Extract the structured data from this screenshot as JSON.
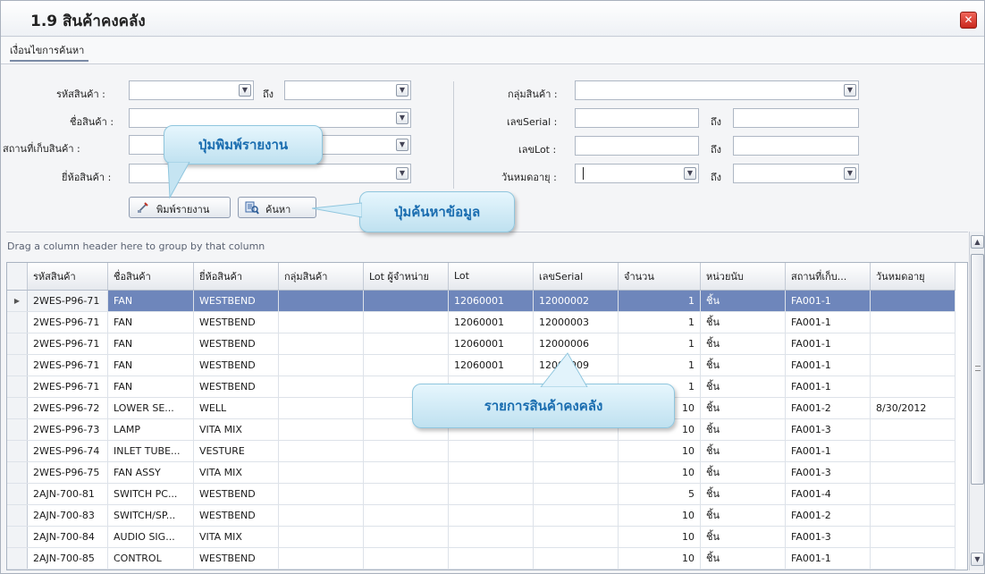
{
  "window": {
    "title": "1.9 สินค้าคงคลัง",
    "close_glyph": "✕"
  },
  "search": {
    "tab_label": "เงื่อนไขการค้นหา",
    "fields": {
      "product_code": {
        "label": "รหัสสินค้า :",
        "to_label": "ถึง"
      },
      "product_name": {
        "label": "ชื่อสินค้า :"
      },
      "location": {
        "label": "สถานที่เก็บสินค้า :"
      },
      "brand": {
        "label": "ยี่ห้อสินค้า :"
      },
      "product_group": {
        "label": "กลุ่มสินค้า :"
      },
      "serial": {
        "label": "เลขSerial :",
        "to_label": "ถึง"
      },
      "lot": {
        "label": "เลขLot :",
        "to_label": "ถึง"
      },
      "expiry": {
        "label": "วันหมดอายุ :",
        "to_label": "ถึง"
      }
    },
    "buttons": {
      "print": "พิมพ์รายงาน",
      "search": "ค้นหา"
    }
  },
  "callouts": {
    "print": "ปุ่มพิมพ์รายงาน",
    "search": "ปุ่มค้นหาข้อมูล",
    "grid": "รายการสินค้าคงคลัง"
  },
  "grid": {
    "group_hint": "Drag a column header here to group by that column",
    "columns": [
      "รหัสสินค้า",
      "ชื่อสินค้า",
      "ยี่ห้อสินค้า",
      "กลุ่มสินค้า",
      "Lot ผู้จำหน่าย",
      "Lot",
      "เลขSerial",
      "จำนวน",
      "หน่วยนับ",
      "สถานที่เก็บ...",
      "วันหมดอายุ"
    ],
    "rows": [
      [
        "2WES-P96-71",
        "FAN",
        "WESTBEND",
        "",
        "",
        "12060001",
        "12000002",
        "1",
        "ชิ้น",
        "FA001-1",
        ""
      ],
      [
        "2WES-P96-71",
        "FAN",
        "WESTBEND",
        "",
        "",
        "12060001",
        "12000003",
        "1",
        "ชิ้น",
        "FA001-1",
        ""
      ],
      [
        "2WES-P96-71",
        "FAN",
        "WESTBEND",
        "",
        "",
        "12060001",
        "12000006",
        "1",
        "ชิ้น",
        "FA001-1",
        ""
      ],
      [
        "2WES-P96-71",
        "FAN",
        "WESTBEND",
        "",
        "",
        "12060001",
        "12000009",
        "1",
        "ชิ้น",
        "FA001-1",
        ""
      ],
      [
        "2WES-P96-71",
        "FAN",
        "WESTBEND",
        "",
        "",
        "",
        "",
        "1",
        "ชิ้น",
        "FA001-1",
        ""
      ],
      [
        "2WES-P96-72",
        "LOWER SE...",
        "WELL",
        "",
        "",
        "",
        "",
        "10",
        "ชิ้น",
        "FA001-2",
        "8/30/2012"
      ],
      [
        "2WES-P96-73",
        "LAMP",
        "VITA MIX",
        "",
        "",
        "",
        "",
        "10",
        "ชิ้น",
        "FA001-3",
        ""
      ],
      [
        "2WES-P96-74",
        "INLET TUBE...",
        "VESTURE",
        "",
        "",
        "",
        "",
        "10",
        "ชิ้น",
        "FA001-1",
        ""
      ],
      [
        "2WES-P96-75",
        "FAN ASSY",
        "VITA MIX",
        "",
        "",
        "",
        "",
        "10",
        "ชิ้น",
        "FA001-3",
        ""
      ],
      [
        "2AJN-700-81",
        "SWITCH PC...",
        "WESTBEND",
        "",
        "",
        "",
        "",
        "5",
        "ชิ้น",
        "FA001-4",
        ""
      ],
      [
        "2AJN-700-83",
        "SWITCH/SP...",
        "WESTBEND",
        "",
        "",
        "",
        "",
        "10",
        "ชิ้น",
        "FA001-2",
        ""
      ],
      [
        "2AJN-700-84",
        "AUDIO SIG...",
        "VITA MIX",
        "",
        "",
        "",
        "",
        "10",
        "ชิ้น",
        "FA001-3",
        ""
      ],
      [
        "2AJN-700-85",
        "CONTROL",
        "WESTBEND",
        "",
        "",
        "",
        "",
        "10",
        "ชิ้น",
        "FA001-1",
        ""
      ]
    ]
  },
  "icons": {
    "dropdown": "chevron-down-icon",
    "print": "print-icon",
    "search": "search-icon"
  }
}
